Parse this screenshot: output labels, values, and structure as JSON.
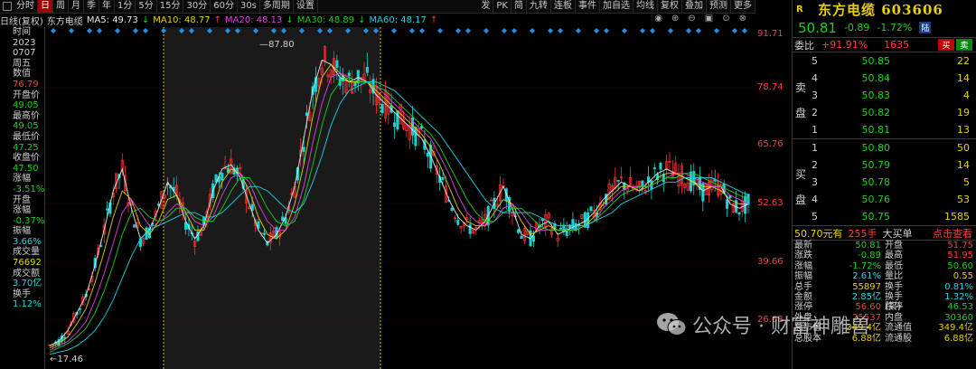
{
  "toolbar": {
    "items": [
      "分时",
      "日",
      "周",
      "月",
      "季",
      "年",
      "1分",
      "5分",
      "15分",
      "30分",
      "60分",
      "30s",
      "多周期",
      "设置"
    ],
    "active_index": 1,
    "right_items": [
      "发",
      "PK",
      "简",
      "九转",
      "连板",
      "事件",
      "加自选",
      "均线",
      "复权",
      "叠加",
      "预测",
      "更多"
    ]
  },
  "ma_line": {
    "prefix": "日线(复权)",
    "stock": "东方电缆",
    "ma5": "MA5: 49.73",
    "ma5_arrow": "↓",
    "ma10": "MA10: 48.77",
    "ma10_arrow": "↑",
    "ma20": "MA20: 48.13",
    "ma20_arrow": "↓",
    "ma30": "MA30: 48.89",
    "ma30_arrow": "↓",
    "ma60": "MA60: 48.17",
    "ma60_arrow": "↑",
    "colors": {
      "ma5": "#e8e8e8",
      "ma10": "#e8d000",
      "ma20": "#e040e0",
      "ma30": "#19d219",
      "ma60": "#1fd5e6"
    }
  },
  "left_panel": {
    "rows": [
      {
        "text": "时间",
        "cls": "lp-label"
      },
      {
        "text": "2023",
        "cls": "lp-label"
      },
      {
        "text": "0707",
        "cls": "lp-label"
      },
      {
        "text": "周五",
        "cls": "lp-label"
      },
      {
        "text": "数值",
        "cls": "lp-label"
      },
      {
        "text": "76.79",
        "cls": "lp-red"
      },
      {
        "text": "开盘价",
        "cls": "lp-label"
      },
      {
        "text": "49.05",
        "cls": "lp-green"
      },
      {
        "text": "最高价",
        "cls": "lp-label"
      },
      {
        "text": "49.05",
        "cls": "lp-green"
      },
      {
        "text": "最低价",
        "cls": "lp-label"
      },
      {
        "text": "47.25",
        "cls": "lp-green"
      },
      {
        "text": "收盘价",
        "cls": "lp-label"
      },
      {
        "text": "47.50",
        "cls": "lp-green"
      },
      {
        "text": "涨幅",
        "cls": "lp-label"
      },
      {
        "text": "-3.51%",
        "cls": "lp-green"
      },
      {
        "text": "开盘",
        "cls": "lp-label"
      },
      {
        "text": "涨幅",
        "cls": "lp-label"
      },
      {
        "text": "-0.37%",
        "cls": "lp-green"
      },
      {
        "text": "振幅",
        "cls": "lp-label"
      },
      {
        "text": "3.66%",
        "cls": "lp-cyan"
      },
      {
        "text": "成交量",
        "cls": "lp-label"
      },
      {
        "text": "76692",
        "cls": "lp-yellow"
      },
      {
        "text": "成交额",
        "cls": "lp-label"
      },
      {
        "text": "3.70亿",
        "cls": "lp-cyan"
      },
      {
        "text": "换手",
        "cls": "lp-label"
      },
      {
        "text": "1.12%",
        "cls": "lp-cyan"
      }
    ]
  },
  "axis": {
    "labels": [
      "91.71",
      "78.74",
      "65.76",
      "52.63",
      "39.66",
      "26.68"
    ]
  },
  "chart_data": {
    "type": "line",
    "title": "",
    "high_marker": "87.80",
    "low_marker": "17.46",
    "ylim": [
      17.46,
      91.71
    ],
    "series": [
      {
        "name": "MA5",
        "color": "#e8e8e8",
        "values": [
          19.5,
          20.5,
          23,
          27,
          31,
          38,
          46,
          55,
          60,
          51,
          44,
          46,
          51,
          57,
          54,
          48,
          44,
          47,
          55,
          60,
          61,
          58,
          52,
          46,
          43,
          45,
          49,
          56,
          67,
          78,
          85,
          84,
          81,
          80,
          81,
          80,
          77,
          75,
          73,
          71,
          69,
          67,
          63,
          58,
          53,
          49,
          47,
          46,
          48,
          52,
          56,
          51,
          45,
          44,
          47,
          48,
          45,
          46,
          47,
          48,
          50,
          53,
          55,
          57,
          56,
          55,
          57,
          59,
          60,
          59,
          58,
          57,
          55,
          56,
          56,
          52,
          51,
          52
        ]
      },
      {
        "name": "MA10",
        "color": "#e8d000",
        "values": [
          19,
          20,
          21.5,
          24.5,
          28,
          34,
          41,
          49,
          55,
          53,
          47,
          45,
          48,
          53,
          54,
          50,
          46,
          46,
          51,
          57,
          60,
          59,
          55,
          49,
          45,
          44,
          46,
          52,
          61,
          72,
          81,
          84,
          82,
          80,
          80,
          80,
          78,
          76,
          74,
          72,
          70,
          68,
          65,
          61,
          56,
          51,
          48,
          47,
          47,
          50,
          53,
          52,
          48,
          45,
          46,
          47,
          46,
          46,
          46,
          47,
          49,
          52,
          54,
          56,
          56,
          55,
          56,
          58,
          59,
          59,
          58,
          57,
          56,
          56,
          55,
          53,
          52,
          52
        ]
      },
      {
        "name": "MA20",
        "color": "#e040e0",
        "values": [
          18.5,
          19.5,
          20.5,
          22.5,
          25,
          30,
          36,
          43,
          50,
          53,
          50,
          47,
          47,
          50,
          52,
          51,
          48,
          47,
          49,
          54,
          58,
          59,
          57,
          52,
          48,
          46,
          46,
          49,
          56,
          66,
          75,
          81,
          82,
          81,
          80,
          80,
          79,
          77,
          75,
          73,
          71,
          69,
          67,
          63,
          59,
          54,
          50,
          48,
          47,
          48,
          51,
          52,
          50,
          47,
          46,
          46,
          46,
          46,
          46,
          47,
          48,
          51,
          53,
          55,
          56,
          56,
          56,
          57,
          58,
          59,
          59,
          58,
          57,
          56,
          56,
          54,
          53,
          52
        ]
      },
      {
        "name": "MA30",
        "color": "#19d219",
        "values": [
          18,
          19,
          20,
          21.5,
          23.5,
          27,
          32,
          38,
          45,
          50,
          51,
          49,
          48,
          49,
          51,
          51,
          49,
          48,
          48,
          51,
          55,
          58,
          58,
          55,
          51,
          48,
          47,
          48,
          53,
          61,
          70,
          77,
          80,
          81,
          80,
          80,
          79,
          78,
          76,
          74,
          72,
          70,
          68,
          65,
          61,
          57,
          53,
          50,
          48,
          48,
          50,
          51,
          51,
          49,
          47,
          46,
          46,
          46,
          46,
          47,
          48,
          50,
          52,
          54,
          55,
          56,
          56,
          57,
          58,
          58,
          59,
          59,
          58,
          57,
          56,
          55,
          54,
          53
        ]
      },
      {
        "name": "MA60",
        "color": "#1fd5e6",
        "values": [
          17.5,
          18,
          18.5,
          19.5,
          21,
          23,
          26,
          30,
          35,
          40,
          44,
          46,
          47,
          48,
          49,
          50,
          50,
          49,
          49,
          50,
          52,
          54,
          56,
          56,
          55,
          53,
          51,
          50,
          52,
          57,
          63,
          70,
          75,
          78,
          79,
          80,
          80,
          79,
          78,
          76,
          74,
          72,
          70,
          68,
          65,
          62,
          59,
          56,
          53,
          51,
          50,
          50,
          50,
          50,
          49,
          48,
          47,
          47,
          47,
          47,
          48,
          49,
          50,
          52,
          53,
          54,
          55,
          56,
          57,
          57,
          58,
          58,
          58,
          58,
          57,
          56,
          55,
          54
        ]
      }
    ]
  },
  "right_panel": {
    "r_mark": "R",
    "stock_name": "东方电缆",
    "stock_code": "603606",
    "price": "50.81",
    "change": "-0.89",
    "change_pct": "-1.72%",
    "tag": "陆",
    "weibi_label": "委比",
    "weibi_value": "+91.91%",
    "weibi_count": "1635",
    "buy_btn": "买",
    "sell_btn": "卖",
    "sell_side_label": [
      "卖",
      "盘"
    ],
    "buy_side_label": [
      "买",
      "盘"
    ],
    "sell_orders": [
      {
        "lvl": "5",
        "price": "50.85",
        "vol": "22"
      },
      {
        "lvl": "4",
        "price": "50.84",
        "vol": "14"
      },
      {
        "lvl": "3",
        "price": "50.83",
        "vol": "4"
      },
      {
        "lvl": "2",
        "price": "50.82",
        "vol": "19"
      },
      {
        "lvl": "1",
        "price": "50.81",
        "vol": "13"
      }
    ],
    "buy_orders": [
      {
        "lvl": "1",
        "price": "50.80",
        "vol": "50"
      },
      {
        "lvl": "2",
        "price": "50.79",
        "vol": "14"
      },
      {
        "lvl": "3",
        "price": "50.78",
        "vol": "5"
      },
      {
        "lvl": "4",
        "price": "50.76",
        "vol": "53"
      },
      {
        "lvl": "5",
        "price": "50.75",
        "vol": "1585"
      }
    ],
    "big_order_price": "50.70元有",
    "big_order_vol": "255手",
    "big_order_label": "大买单",
    "big_order_link": "点击查看",
    "stats": [
      {
        "l": "最新",
        "lv": "50.81",
        "lc": "c-green",
        "r": "开盘",
        "rv": "51.75",
        "rc": "c-red"
      },
      {
        "l": "涨跌",
        "lv": "-0.89",
        "lc": "c-green",
        "r": "最高",
        "rv": "51.95",
        "rc": "c-red"
      },
      {
        "l": "涨幅",
        "lv": "-1.72%",
        "lc": "c-green",
        "r": "最低",
        "rv": "50.60",
        "rc": "c-green"
      },
      {
        "l": "振幅",
        "lv": "2.61%",
        "lc": "c-cyan",
        "r": "量比",
        "rv": "0.55",
        "rc": "c-yellow"
      },
      {
        "l": "总手",
        "lv": "55897",
        "lc": "c-yellow",
        "r": "换手",
        "rv": "0.81%",
        "rc": "c-cyan"
      },
      {
        "l": "金额",
        "lv": "2.85亿",
        "lc": "c-cyan",
        "r": "换手(实)",
        "rv": "1.32%",
        "rc": "c-cyan"
      },
      {
        "l": "涨停",
        "lv": "56.60",
        "lc": "c-red",
        "r": "跌停",
        "rv": "46.53",
        "rc": "c-green"
      },
      {
        "l": "外盘",
        "lv": "25537",
        "lc": "c-red",
        "r": "内盘",
        "rv": "30360",
        "rc": "c-green"
      },
      {
        "l": "总市值",
        "lv": "349.4亿",
        "lc": "c-yellow",
        "r": "流通值",
        "rv": "349.4亿",
        "rc": "c-yellow"
      },
      {
        "l": "总股本",
        "lv": "6.88亿",
        "lc": "c-yellow",
        "r": "流通股",
        "rv": "6.88亿",
        "rc": "c-yellow"
      }
    ]
  },
  "watermark": {
    "text": "公众号 · 财富神雕兽"
  }
}
